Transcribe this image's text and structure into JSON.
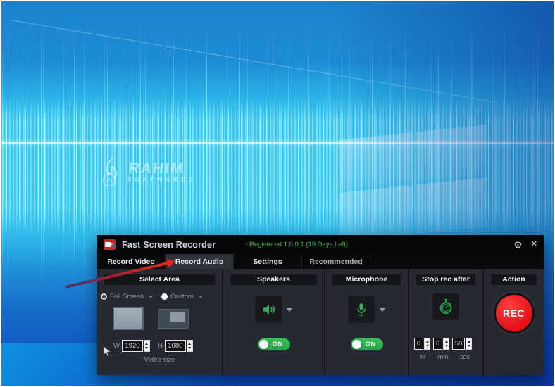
{
  "desktop": {
    "watermark_line1": "RAHIM",
    "watermark_line2": "SOFTWARES"
  },
  "titlebar": {
    "app_title": "Fast Screen Recorder",
    "registration_status": "- Registered 1.0.0.1 (19 Days Left)"
  },
  "tabs": [
    {
      "label": "Record Video"
    },
    {
      "label": "Record Audio"
    },
    {
      "label": "Settings"
    },
    {
      "label": "Recommended"
    }
  ],
  "select_area": {
    "header": "Select Area",
    "full_screen_label": "Full Screen",
    "custom_label": "Custom",
    "width_label": "W",
    "width_value": "1920",
    "height_label": "H",
    "height_value": "1080",
    "video_size_label": "Video size"
  },
  "speakers": {
    "header": "Speakers",
    "toggle_label": "ON"
  },
  "microphone": {
    "header": "Microphone",
    "toggle_label": "ON"
  },
  "stop_rec_after": {
    "header": "Stop rec after",
    "hours_value": "0",
    "minutes_value": "6",
    "seconds_value": "50",
    "hours_label": "hr",
    "minutes_label": "min",
    "seconds_label": "sec"
  },
  "action": {
    "header": "Action",
    "rec_button_label": "REC"
  },
  "colors": {
    "accent_green": "#2fae53",
    "rec_red": "#e2101a",
    "registered_green": "#3cb94c",
    "toggle_green": "#23a343"
  }
}
